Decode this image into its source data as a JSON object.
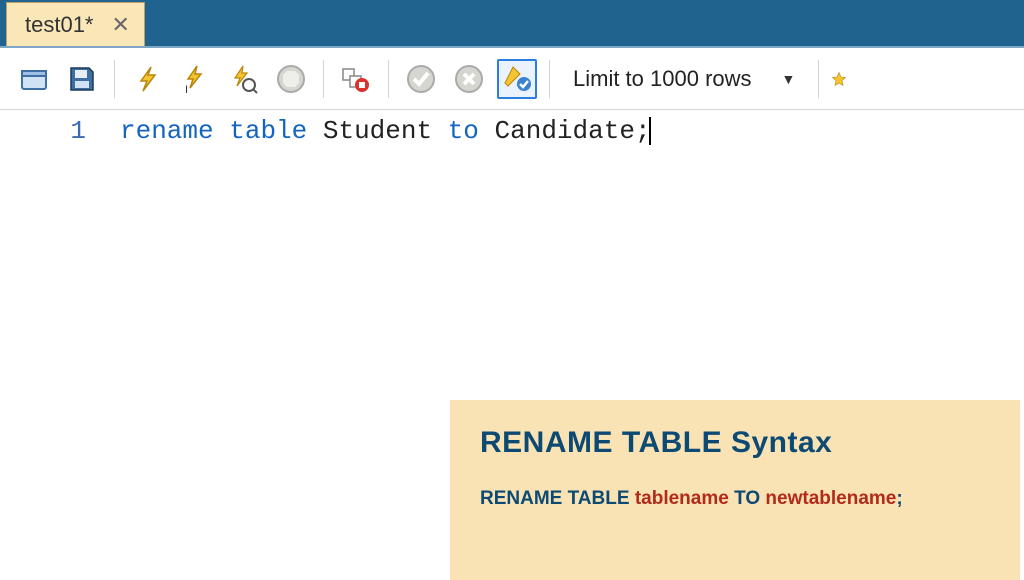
{
  "tab": {
    "title": "test01*",
    "close": "✕"
  },
  "toolbar": {
    "limit_label": "Limit to 1000 rows"
  },
  "editor": {
    "gutter": [
      "1"
    ],
    "code": {
      "kw_rename": "rename",
      "kw_table": "table",
      "ident1": "Student",
      "kw_to": "to",
      "ident2": "Candidate",
      "semi": ";"
    }
  },
  "info": {
    "title": "RENAME  TABLE Syntax",
    "syntax": {
      "kw1": "RENAME  TABLE",
      "arg1": "tablename",
      "kw2": "TO",
      "arg2": "newtablename",
      "punc": ";"
    }
  }
}
